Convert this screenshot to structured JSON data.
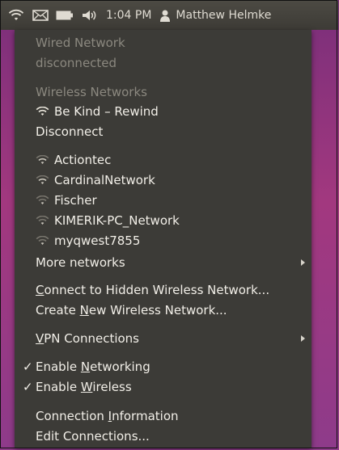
{
  "panel": {
    "time": "1:04 PM",
    "user": "Matthew Helmke",
    "icons": [
      "wifi-icon",
      "mail-icon",
      "battery-icon",
      "volume-icon",
      "user-icon"
    ]
  },
  "menu": {
    "wired_header": "Wired Network",
    "wired_status": "disconnected",
    "wireless_header": "Wireless Networks",
    "connected_network": "Be Kind – Rewind",
    "disconnect": "Disconnect",
    "networks": [
      "Actiontec",
      "CardinalNetwork",
      "Fischer",
      "KIMERIK-PC_Network",
      "myqwest7855"
    ],
    "more_networks": "More networks",
    "connect_hidden": {
      "pre": "",
      "u": "C",
      "post": "onnect to Hidden Wireless Network..."
    },
    "create_new": {
      "pre": "Create ",
      "u": "N",
      "post": "ew Wireless Network..."
    },
    "vpn": {
      "pre": "",
      "u": "V",
      "post": "PN Connections"
    },
    "enable_networking": {
      "pre": "Enable ",
      "u": "N",
      "post": "etworking"
    },
    "enable_wireless": {
      "pre": "Enable ",
      "u": "W",
      "post": "ireless"
    },
    "connection_info": {
      "pre": "Connection ",
      "u": "I",
      "post": "nformation"
    },
    "edit_connections": "Edit Connections...",
    "check_mark": "✓"
  },
  "colors": {
    "menu_bg": "#3c3b37",
    "panel_bg": "#3d3b36",
    "disabled_text": "#8b887f",
    "text": "#f2efe8"
  }
}
